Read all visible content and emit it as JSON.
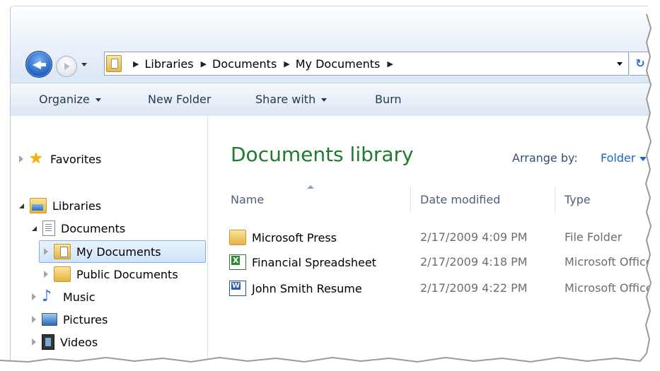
{
  "address": {
    "crumbs": [
      "Libraries",
      "Documents",
      "My Documents"
    ]
  },
  "toolbar": {
    "organize": "Organize",
    "new_folder": "New Folder",
    "share_with": "Share with",
    "burn": "Burn"
  },
  "nav": {
    "favorites": "Favorites",
    "libraries": "Libraries",
    "documents": "Documents",
    "my_documents": "My Documents",
    "public_documents": "Public Documents",
    "music": "Music",
    "pictures": "Pictures",
    "videos": "Videos"
  },
  "content": {
    "title": "Documents library",
    "arrange_label": "Arrange by:",
    "arrange_value": "Folder",
    "columns": {
      "name": "Name",
      "date": "Date modified",
      "type": "Type"
    },
    "files": [
      {
        "name": "Microsoft Press",
        "date": "2/17/2009 4:09 PM",
        "type": "File Folder",
        "icon": "folder-icon"
      },
      {
        "name": "Financial Spreadsheet",
        "date": "2/17/2009 4:18 PM",
        "type": "Microsoft Office",
        "icon": "excel-file-icon"
      },
      {
        "name": "John Smith Resume",
        "date": "2/17/2009 4:22 PM",
        "type": "Microsoft Office",
        "icon": "word-file-icon"
      }
    ]
  },
  "colors": {
    "title_green": "#1e7b2f",
    "link_blue": "#1b66c9",
    "toolbar_text": "#1e395b",
    "selection_border": "#84acdd"
  }
}
